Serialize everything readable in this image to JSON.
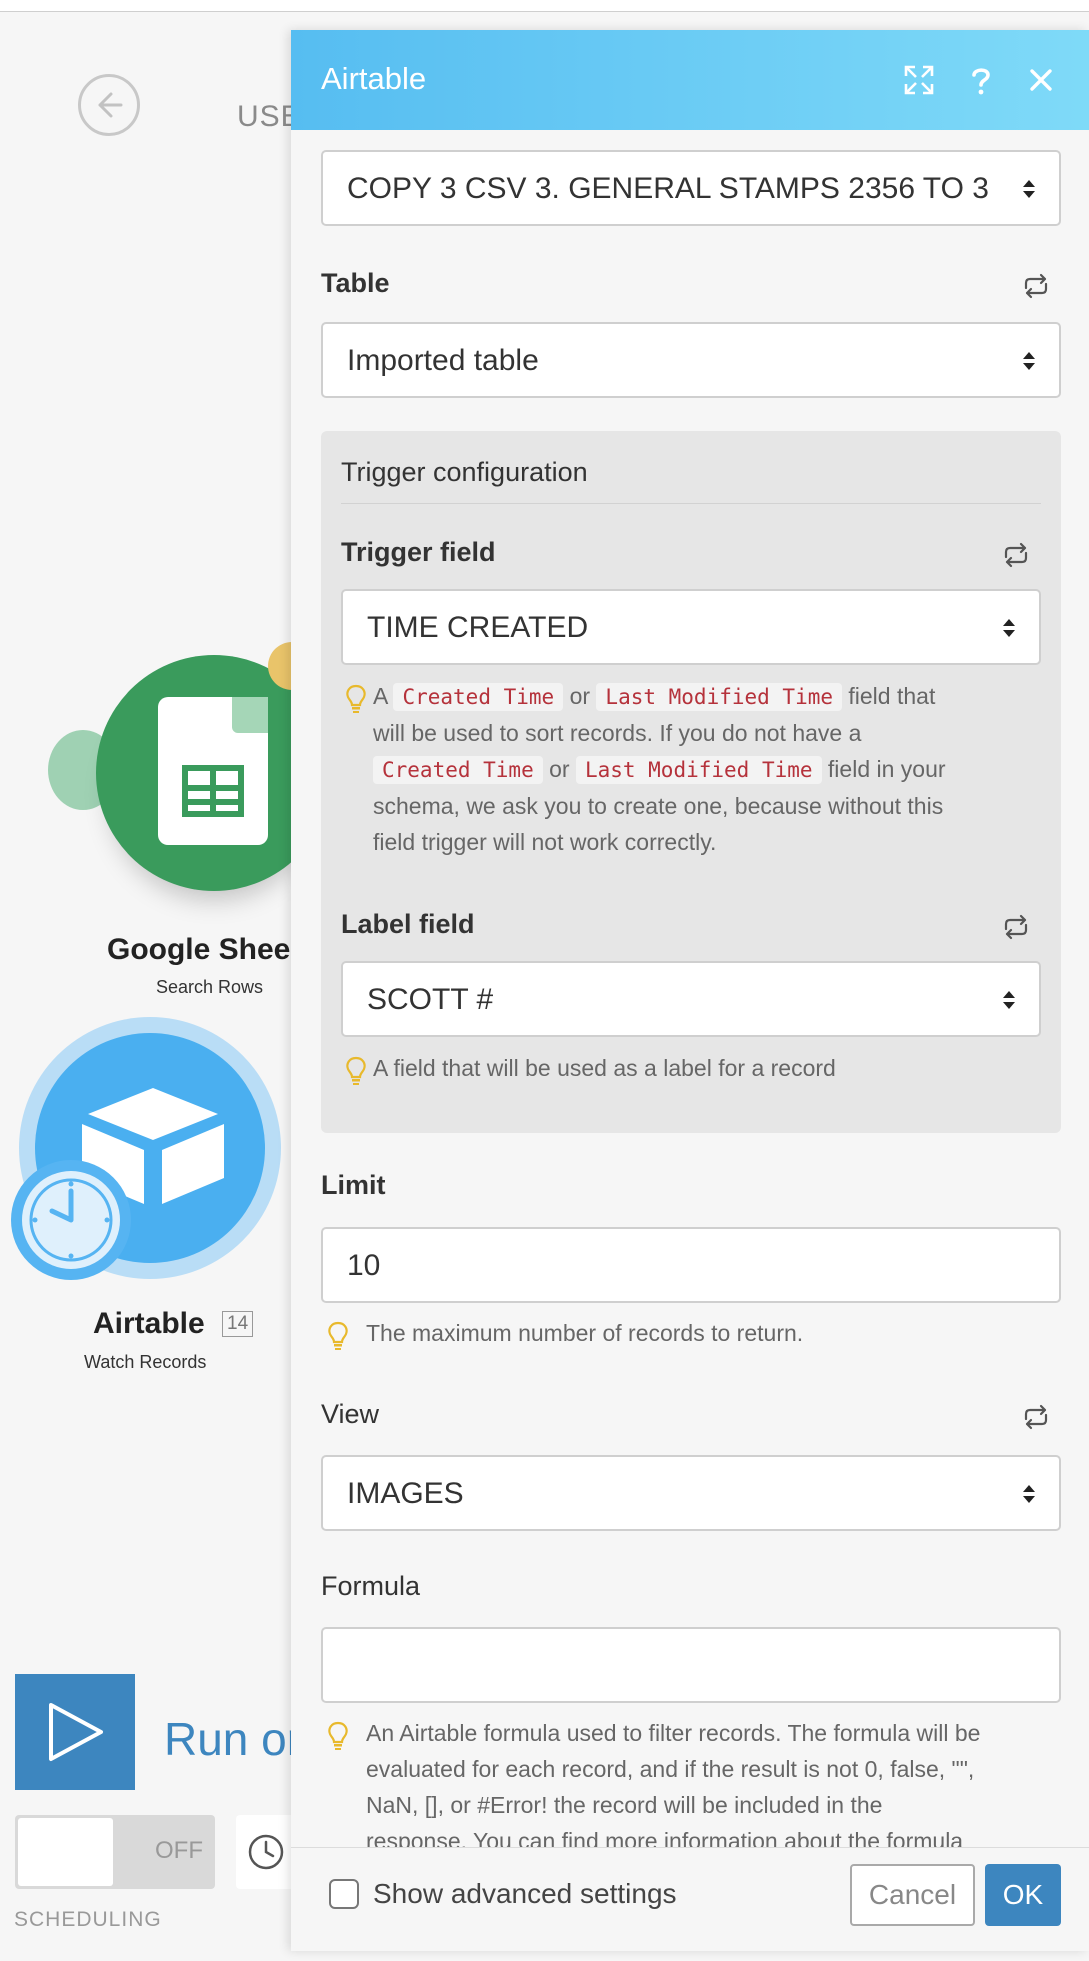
{
  "scenario": {
    "name_fragment": "USE"
  },
  "modules": {
    "google_sheets": {
      "title": "Google Shee",
      "subtitle": "Search Rows"
    },
    "airtable": {
      "title": "Airtable",
      "badge": "14",
      "subtitle": "Watch Records"
    }
  },
  "run": {
    "label": "Run or"
  },
  "scheduling": {
    "toggle_state": "OFF",
    "label": "SCHEDULING"
  },
  "panel": {
    "title": "Airtable",
    "base": {
      "value": "COPY 3 CSV 3. GENERAL STAMPS 2356 TO 3"
    },
    "table": {
      "label": "Table",
      "value": "Imported table"
    },
    "trigger": {
      "section_title": "Trigger configuration",
      "field_label": "Trigger field",
      "field_value": "TIME CREATED",
      "hint": {
        "w_a": "A",
        "code_created": "Created Time",
        "w_or": "or",
        "code_modified": "Last Modified Time",
        "w_field_that": "field that",
        "line2": "will be used to sort records. If you do not have a",
        "w_field_in_your": "field in your",
        "line4": "schema, we ask you to create one, because without this",
        "line5": "field trigger will not work correctly."
      },
      "label_field_label": "Label field",
      "label_field_value": "SCOTT #",
      "label_hint": "A field that will be used as a label for a record"
    },
    "limit": {
      "label": "Limit",
      "value": "10",
      "hint": "The maximum number of records to return."
    },
    "view": {
      "label": "View",
      "value": "IMAGES"
    },
    "formula": {
      "label": "Formula",
      "value": "",
      "hint_lines": [
        "An Airtable formula used to filter records. The formula will be",
        "evaluated for each record, and if the result is not 0, false, \"\",",
        "NaN, [], or #Error! the record will be included in the",
        "response. You can find more information about the formula"
      ]
    },
    "footer": {
      "advanced_label": "Show advanced settings",
      "cancel_label": "Cancel",
      "ok_label": "OK"
    }
  },
  "colors": {
    "accent": "#3d86bf",
    "header_start": "#56bdf1",
    "header_end": "#7fdaf8",
    "sheets_green": "#3a9b5c",
    "airtable_blue": "#4aaff0",
    "code_red": "#b5323b"
  },
  "icons": [
    "back-arrow-icon",
    "expand-icon",
    "help-icon",
    "close-icon",
    "refresh-icon",
    "select-arrows-icon",
    "lightbulb-icon",
    "play-icon",
    "clock-icon",
    "spreadsheet-icon",
    "cube-icon"
  ]
}
